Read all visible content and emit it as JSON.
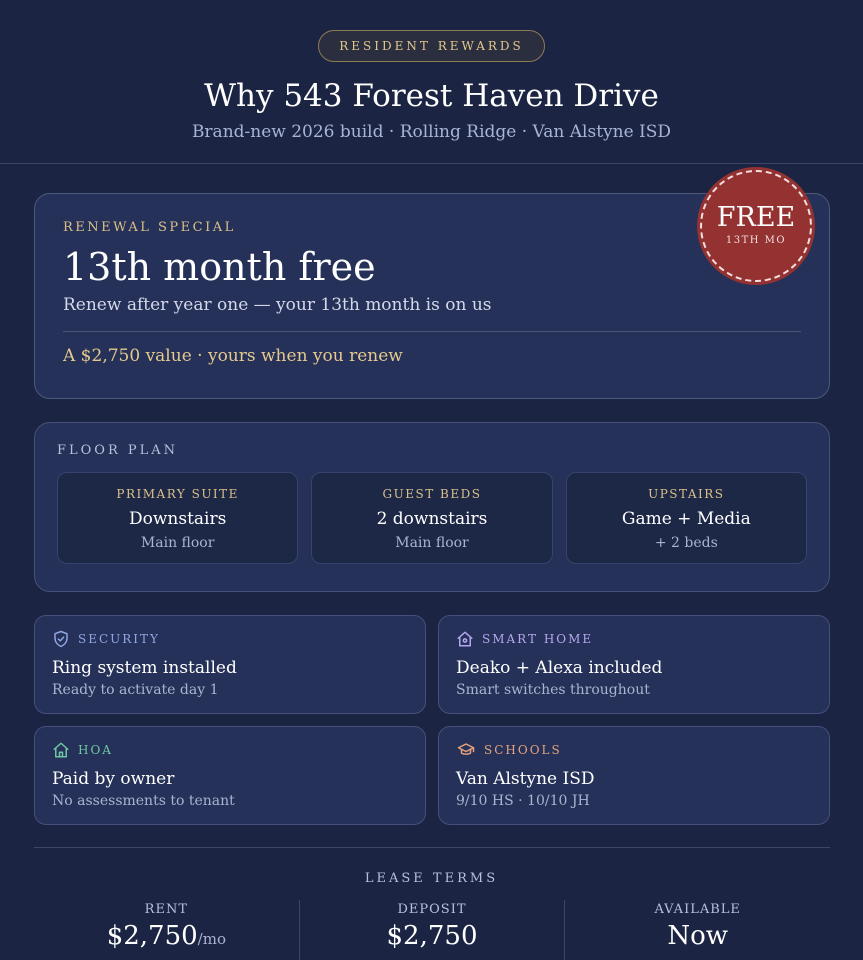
{
  "header": {
    "pill": "RESIDENT REWARDS",
    "title": "Why 543 Forest Haven Drive",
    "subtitle": "Brand-new 2026 build · Rolling Ridge · Van Alstyne ISD"
  },
  "special": {
    "eyebrow": "RENEWAL SPECIAL",
    "headline": "13th month free",
    "description": "Renew after year one — your 13th month is on us",
    "value": "A $2,750 value · yours when you renew",
    "badge_main": "FREE",
    "badge_sub": "13TH MO"
  },
  "floor_plan": {
    "title": "FLOOR PLAN",
    "items": [
      {
        "label": "PRIMARY SUITE",
        "value": "Downstairs",
        "sub": "Main floor"
      },
      {
        "label": "GUEST BEDS",
        "value": "2 downstairs",
        "sub": "Main floor"
      },
      {
        "label": "UPSTAIRS",
        "value": "Game + Media",
        "sub": "+ 2 beds"
      }
    ]
  },
  "features": [
    {
      "label": "SECURITY",
      "value": "Ring system installed",
      "sub": "Ready to activate day 1",
      "icon": "shield-icon",
      "color": "#8fa6e2"
    },
    {
      "label": "SMART HOME",
      "value": "Deako + Alexa included",
      "sub": "Smart switches throughout",
      "icon": "home-icon",
      "color": "#b6a7ef"
    },
    {
      "label": "HOA",
      "value": "Paid by owner",
      "sub": "No assessments to tenant",
      "icon": "house-icon",
      "color": "#6ec7a4"
    },
    {
      "label": "SCHOOLS",
      "value": "Van Alstyne ISD",
      "sub": "9/10 HS · 10/10 JH",
      "icon": "graduation-cap-icon",
      "color": "#e6a37e"
    }
  ],
  "lease": {
    "title": "LEASE TERMS",
    "terms": [
      {
        "label": "RENT",
        "value": "$2,750",
        "unit": "/mo"
      },
      {
        "label": "DEPOSIT",
        "value": "$2,750",
        "unit": ""
      },
      {
        "label": "AVAILABLE",
        "value": "Now",
        "unit": ""
      }
    ]
  }
}
